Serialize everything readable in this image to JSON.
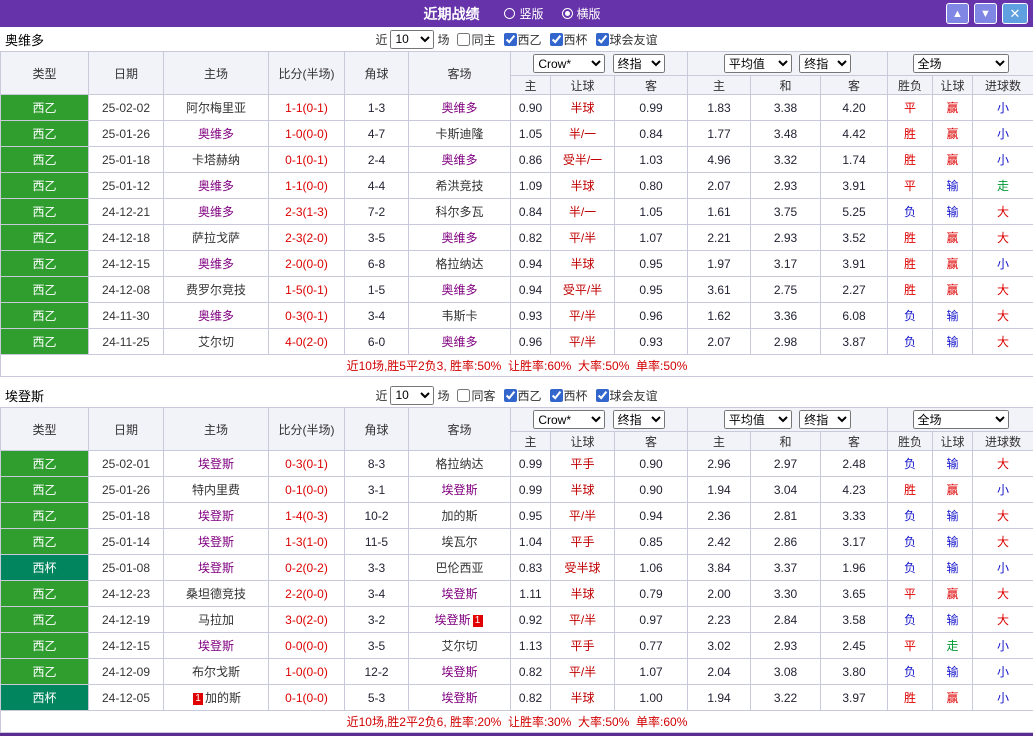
{
  "colors": {
    "topbar": "#6633AA",
    "liga": "#2F9E2F",
    "cup": "#00855E",
    "focus": "#800080",
    "red": "#DD0000",
    "blue": "#1515CC",
    "green": "#009933"
  },
  "topbar": {
    "title": "近期战绩",
    "radios": [
      {
        "label": "竖版",
        "selected": false
      },
      {
        "label": "横版",
        "selected": true
      }
    ],
    "up_icon": "▲",
    "down_icon": "▼",
    "close_icon": "✕"
  },
  "table_header": {
    "type": "类型",
    "date": "日期",
    "home": "主场",
    "score": "比分(半场)",
    "corner": "角球",
    "away": "客场",
    "odds_select": "Crow*",
    "final_select": "终指",
    "avg_select": "平均值",
    "scope_select": "全场",
    "odds_home": "主",
    "odds_let": "让球",
    "odds_away": "客",
    "avg_home": "主",
    "avg_draw": "和",
    "avg_away": "客",
    "res_wdl": "胜负",
    "res_let": "让球",
    "res_goals": "进球数"
  },
  "sections": [
    {
      "team": "奥维多",
      "filter": {
        "prefix": "近",
        "count": "10",
        "suffix": "场",
        "same": "同主",
        "same_checked": false,
        "leagues": [
          {
            "label": "西乙",
            "checked": true
          },
          {
            "label": "西杯",
            "checked": true
          },
          {
            "label": "球会友谊",
            "checked": true
          }
        ]
      },
      "rows": [
        {
          "league": "西乙",
          "type": "liga2",
          "date": "25-02-02",
          "home": "阿尔梅里亚",
          "home_focus": false,
          "score": "1-1(0-1)",
          "corner": "1-3",
          "away": "奥维多",
          "away_focus": true,
          "odds": [
            "0.90",
            "半球",
            "0.99"
          ],
          "avg": [
            "1.83",
            "3.38",
            "4.20"
          ],
          "results": [
            {
              "t": "平",
              "c": "red"
            },
            {
              "t": "赢",
              "c": "red"
            },
            {
              "t": "小",
              "c": "blue"
            }
          ]
        },
        {
          "league": "西乙",
          "type": "liga2",
          "date": "25-01-26",
          "home": "奥维多",
          "home_focus": true,
          "score": "1-0(0-0)",
          "corner": "4-7",
          "away": "卡斯迪隆",
          "away_focus": false,
          "odds": [
            "1.05",
            "半/一",
            "0.84"
          ],
          "avg": [
            "1.77",
            "3.48",
            "4.42"
          ],
          "results": [
            {
              "t": "胜",
              "c": "red"
            },
            {
              "t": "赢",
              "c": "red"
            },
            {
              "t": "小",
              "c": "blue"
            }
          ]
        },
        {
          "league": "西乙",
          "type": "liga2",
          "date": "25-01-18",
          "home": "卡塔赫纳",
          "home_focus": false,
          "score": "0-1(0-1)",
          "corner": "2-4",
          "away": "奥维多",
          "away_focus": true,
          "odds": [
            "0.86",
            "受半/一",
            "1.03"
          ],
          "avg": [
            "4.96",
            "3.32",
            "1.74"
          ],
          "results": [
            {
              "t": "胜",
              "c": "red"
            },
            {
              "t": "赢",
              "c": "red"
            },
            {
              "t": "小",
              "c": "blue"
            }
          ]
        },
        {
          "league": "西乙",
          "type": "liga2",
          "date": "25-01-12",
          "home": "奥维多",
          "home_focus": true,
          "score": "1-1(0-0)",
          "corner": "4-4",
          "away": "希洪竞技",
          "away_focus": false,
          "odds": [
            "1.09",
            "半球",
            "0.80"
          ],
          "avg": [
            "2.07",
            "2.93",
            "3.91"
          ],
          "results": [
            {
              "t": "平",
              "c": "red"
            },
            {
              "t": "输",
              "c": "blue"
            },
            {
              "t": "走",
              "c": "green"
            }
          ]
        },
        {
          "league": "西乙",
          "type": "liga2",
          "date": "24-12-21",
          "home": "奥维多",
          "home_focus": true,
          "score": "2-3(1-3)",
          "corner": "7-2",
          "away": "科尔多瓦",
          "away_focus": false,
          "odds": [
            "0.84",
            "半/一",
            "1.05"
          ],
          "avg": [
            "1.61",
            "3.75",
            "5.25"
          ],
          "results": [
            {
              "t": "负",
              "c": "blue"
            },
            {
              "t": "输",
              "c": "blue"
            },
            {
              "t": "大",
              "c": "red"
            }
          ]
        },
        {
          "league": "西乙",
          "type": "liga2",
          "date": "24-12-18",
          "home": "萨拉戈萨",
          "home_focus": false,
          "score": "2-3(2-0)",
          "corner": "3-5",
          "away": "奥维多",
          "away_focus": true,
          "odds": [
            "0.82",
            "平/半",
            "1.07"
          ],
          "avg": [
            "2.21",
            "2.93",
            "3.52"
          ],
          "results": [
            {
              "t": "胜",
              "c": "red"
            },
            {
              "t": "赢",
              "c": "red"
            },
            {
              "t": "大",
              "c": "red"
            }
          ]
        },
        {
          "league": "西乙",
          "type": "liga2",
          "date": "24-12-15",
          "home": "奥维多",
          "home_focus": true,
          "score": "2-0(0-0)",
          "corner": "6-8",
          "away": "格拉纳达",
          "away_focus": false,
          "odds": [
            "0.94",
            "半球",
            "0.95"
          ],
          "avg": [
            "1.97",
            "3.17",
            "3.91"
          ],
          "results": [
            {
              "t": "胜",
              "c": "red"
            },
            {
              "t": "赢",
              "c": "red"
            },
            {
              "t": "小",
              "c": "blue"
            }
          ]
        },
        {
          "league": "西乙",
          "type": "liga2",
          "date": "24-12-08",
          "home": "费罗尔竞技",
          "home_focus": false,
          "score": "1-5(0-1)",
          "corner": "1-5",
          "away": "奥维多",
          "away_focus": true,
          "odds": [
            "0.94",
            "受平/半",
            "0.95"
          ],
          "avg": [
            "3.61",
            "2.75",
            "2.27"
          ],
          "results": [
            {
              "t": "胜",
              "c": "red"
            },
            {
              "t": "赢",
              "c": "red"
            },
            {
              "t": "大",
              "c": "red"
            }
          ]
        },
        {
          "league": "西乙",
          "type": "liga2",
          "date": "24-11-30",
          "home": "奥维多",
          "home_focus": true,
          "score": "0-3(0-1)",
          "corner": "3-4",
          "away": "韦斯卡",
          "away_focus": false,
          "odds": [
            "0.93",
            "平/半",
            "0.96"
          ],
          "avg": [
            "1.62",
            "3.36",
            "6.08"
          ],
          "results": [
            {
              "t": "负",
              "c": "blue"
            },
            {
              "t": "输",
              "c": "blue"
            },
            {
              "t": "大",
              "c": "red"
            }
          ]
        },
        {
          "league": "西乙",
          "type": "liga2",
          "date": "24-11-25",
          "home": "艾尔切",
          "home_focus": false,
          "score": "4-0(2-0)",
          "corner": "6-0",
          "away": "奥维多",
          "away_focus": true,
          "odds": [
            "0.96",
            "平/半",
            "0.93"
          ],
          "avg": [
            "2.07",
            "2.98",
            "3.87"
          ],
          "results": [
            {
              "t": "负",
              "c": "blue"
            },
            {
              "t": "输",
              "c": "blue"
            },
            {
              "t": "大",
              "c": "red"
            }
          ]
        }
      ],
      "summary": "近10场,胜5平2负3, 胜率:50%  让胜率:60%  大率:50%  单率:50%"
    },
    {
      "team": "埃登斯",
      "filter": {
        "prefix": "近",
        "count": "10",
        "suffix": "场",
        "same": "同客",
        "same_checked": false,
        "leagues": [
          {
            "label": "西乙",
            "checked": true
          },
          {
            "label": "西杯",
            "checked": true
          },
          {
            "label": "球会友谊",
            "checked": true
          }
        ]
      },
      "rows": [
        {
          "league": "西乙",
          "type": "liga2",
          "date": "25-02-01",
          "home": "埃登斯",
          "home_focus": true,
          "score": "0-3(0-1)",
          "corner": "8-3",
          "away": "格拉纳达",
          "away_focus": false,
          "odds": [
            "0.99",
            "平手",
            "0.90"
          ],
          "avg": [
            "2.96",
            "2.97",
            "2.48"
          ],
          "results": [
            {
              "t": "负",
              "c": "blue"
            },
            {
              "t": "输",
              "c": "blue"
            },
            {
              "t": "大",
              "c": "red"
            }
          ]
        },
        {
          "league": "西乙",
          "type": "liga2",
          "date": "25-01-26",
          "home": "特内里费",
          "home_focus": false,
          "score": "0-1(0-0)",
          "corner": "3-1",
          "away": "埃登斯",
          "away_focus": true,
          "odds": [
            "0.99",
            "半球",
            "0.90"
          ],
          "avg": [
            "1.94",
            "3.04",
            "4.23"
          ],
          "results": [
            {
              "t": "胜",
              "c": "red"
            },
            {
              "t": "赢",
              "c": "red"
            },
            {
              "t": "小",
              "c": "blue"
            }
          ]
        },
        {
          "league": "西乙",
          "type": "liga2",
          "date": "25-01-18",
          "home": "埃登斯",
          "home_focus": true,
          "score": "1-4(0-3)",
          "corner": "10-2",
          "away": "加的斯",
          "away_focus": false,
          "odds": [
            "0.95",
            "平/半",
            "0.94"
          ],
          "avg": [
            "2.36",
            "2.81",
            "3.33"
          ],
          "results": [
            {
              "t": "负",
              "c": "blue"
            },
            {
              "t": "输",
              "c": "blue"
            },
            {
              "t": "大",
              "c": "red"
            }
          ]
        },
        {
          "league": "西乙",
          "type": "liga2",
          "date": "25-01-14",
          "home": "埃登斯",
          "home_focus": true,
          "score": "1-3(1-0)",
          "corner": "11-5",
          "away": "埃瓦尔",
          "away_focus": false,
          "odds": [
            "1.04",
            "平手",
            "0.85"
          ],
          "avg": [
            "2.42",
            "2.86",
            "3.17"
          ],
          "results": [
            {
              "t": "负",
              "c": "blue"
            },
            {
              "t": "输",
              "c": "blue"
            },
            {
              "t": "大",
              "c": "red"
            }
          ]
        },
        {
          "league": "西杯",
          "type": "cup",
          "date": "25-01-08",
          "home": "埃登斯",
          "home_focus": true,
          "score": "0-2(0-2)",
          "corner": "3-3",
          "away": "巴伦西亚",
          "away_focus": false,
          "odds": [
            "0.83",
            "受半球",
            "1.06"
          ],
          "avg": [
            "3.84",
            "3.37",
            "1.96"
          ],
          "results": [
            {
              "t": "负",
              "c": "blue"
            },
            {
              "t": "输",
              "c": "blue"
            },
            {
              "t": "小",
              "c": "blue"
            }
          ]
        },
        {
          "league": "西乙",
          "type": "liga2",
          "date": "24-12-23",
          "home": "桑坦德竞技",
          "home_focus": false,
          "score": "2-2(0-0)",
          "corner": "3-4",
          "away": "埃登斯",
          "away_focus": true,
          "odds": [
            "1.11",
            "半球",
            "0.79"
          ],
          "avg": [
            "2.00",
            "3.30",
            "3.65"
          ],
          "results": [
            {
              "t": "平",
              "c": "red"
            },
            {
              "t": "赢",
              "c": "red"
            },
            {
              "t": "大",
              "c": "red"
            }
          ]
        },
        {
          "league": "西乙",
          "type": "liga2",
          "date": "24-12-19",
          "home": "马拉加",
          "home_focus": false,
          "score": "3-0(2-0)",
          "corner": "3-2",
          "away": "埃登斯",
          "away_focus": true,
          "away_card": "1",
          "odds": [
            "0.92",
            "平/半",
            "0.97"
          ],
          "avg": [
            "2.23",
            "2.84",
            "3.58"
          ],
          "results": [
            {
              "t": "负",
              "c": "blue"
            },
            {
              "t": "输",
              "c": "blue"
            },
            {
              "t": "大",
              "c": "red"
            }
          ]
        },
        {
          "league": "西乙",
          "type": "liga2",
          "date": "24-12-15",
          "home": "埃登斯",
          "home_focus": true,
          "score": "0-0(0-0)",
          "corner": "3-5",
          "away": "艾尔切",
          "away_focus": false,
          "odds": [
            "1.13",
            "平手",
            "0.77"
          ],
          "avg": [
            "3.02",
            "2.93",
            "2.45"
          ],
          "results": [
            {
              "t": "平",
              "c": "red"
            },
            {
              "t": "走",
              "c": "green"
            },
            {
              "t": "小",
              "c": "blue"
            }
          ]
        },
        {
          "league": "西乙",
          "type": "liga2",
          "date": "24-12-09",
          "home": "布尔戈斯",
          "home_focus": false,
          "score": "1-0(0-0)",
          "corner": "12-2",
          "away": "埃登斯",
          "away_focus": true,
          "odds": [
            "0.82",
            "平/半",
            "1.07"
          ],
          "avg": [
            "2.04",
            "3.08",
            "3.80"
          ],
          "results": [
            {
              "t": "负",
              "c": "blue"
            },
            {
              "t": "输",
              "c": "blue"
            },
            {
              "t": "小",
              "c": "blue"
            }
          ]
        },
        {
          "league": "西杯",
          "type": "cup",
          "date": "24-12-05",
          "home": "加的斯",
          "home_focus": false,
          "home_card": "1",
          "score": "0-1(0-0)",
          "corner": "5-3",
          "away": "埃登斯",
          "away_focus": true,
          "odds": [
            "0.82",
            "半球",
            "1.00"
          ],
          "avg": [
            "1.94",
            "3.22",
            "3.97"
          ],
          "results": [
            {
              "t": "胜",
              "c": "red"
            },
            {
              "t": "赢",
              "c": "red"
            },
            {
              "t": "小",
              "c": "blue"
            }
          ]
        }
      ],
      "summary": "近10场,胜2平2负6, 胜率:20%  让胜率:30%  大率:50%  单率:60%"
    }
  ]
}
